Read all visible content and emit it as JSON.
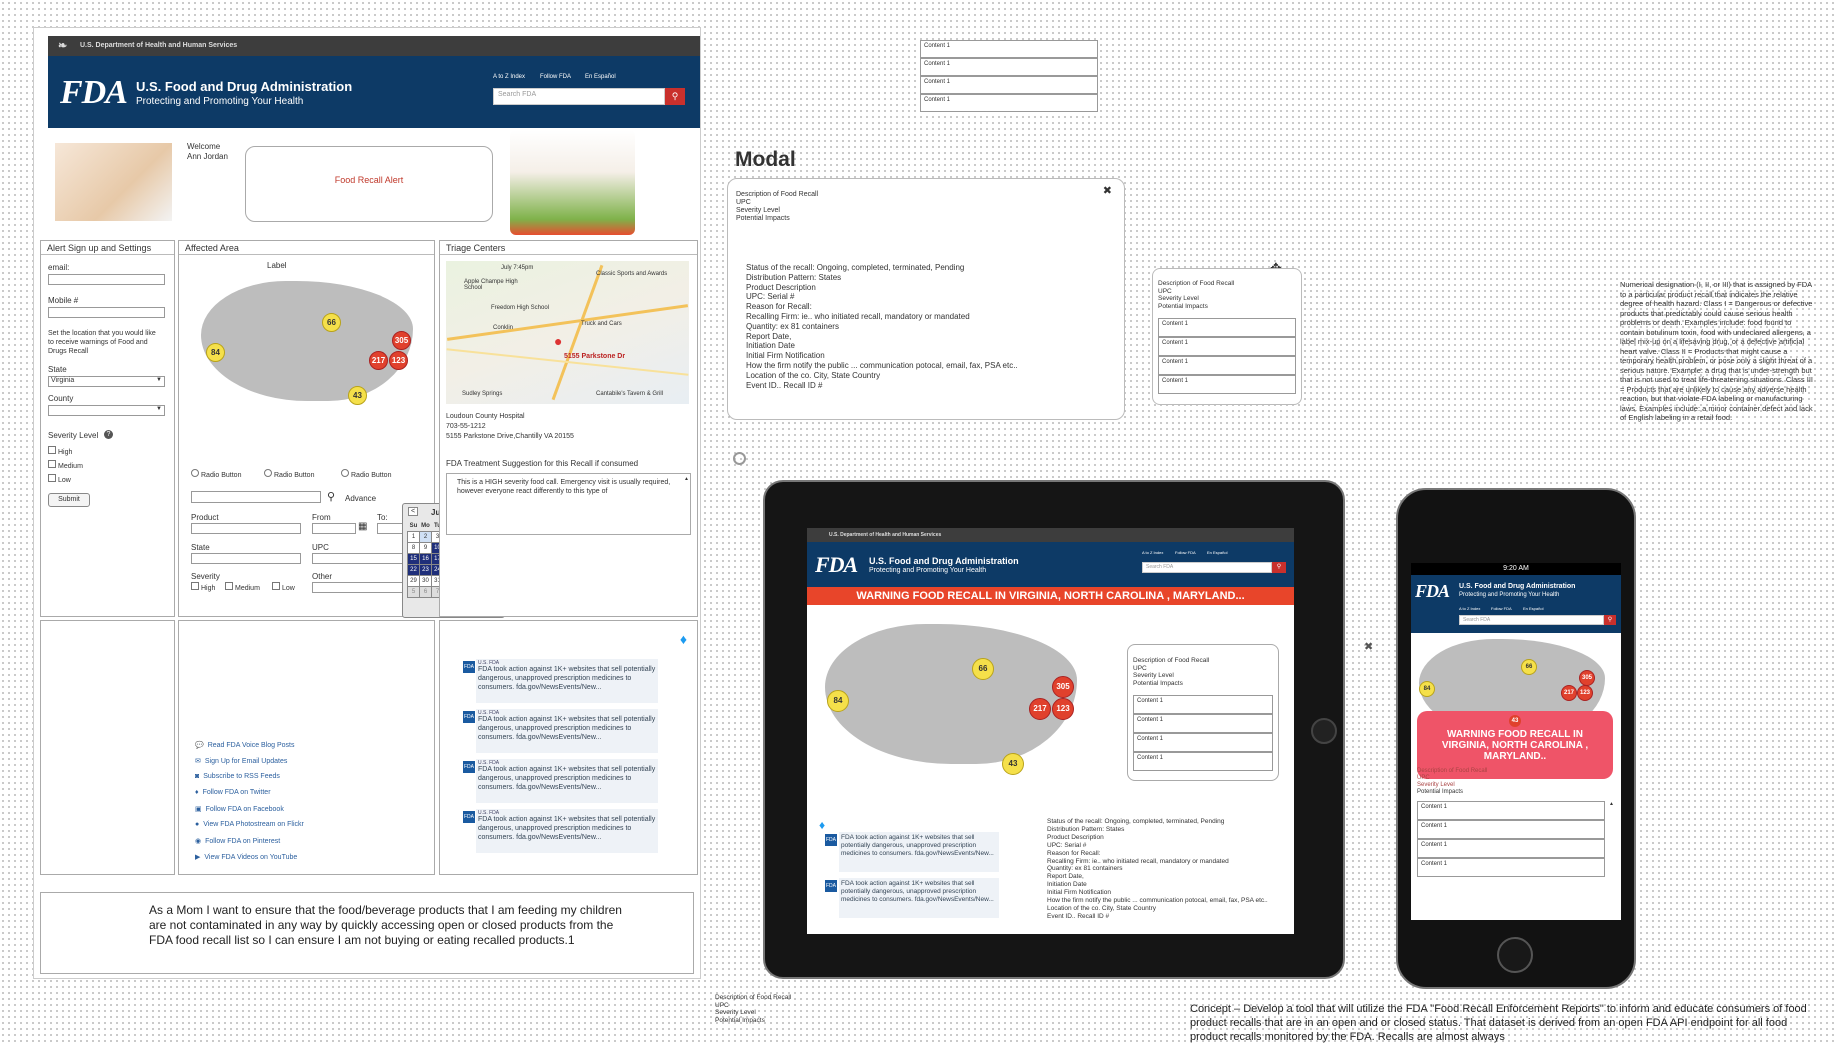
{
  "header": {
    "hhs_label": "U.S. Department of Health and Human Services",
    "title": "U.S. Food and Drug Administration",
    "subtitle": "Protecting and Promoting Your Health",
    "logo": "FDA",
    "nav": [
      "A to Z Index",
      "Follow FDA",
      "En Español"
    ],
    "search_placeholder": "Search FDA"
  },
  "welcome": {
    "label": "Welcome",
    "name": "Ann Jordan",
    "alert": "Food Recall Alert"
  },
  "alert_panel": {
    "title": "Alert Sign up and Settings",
    "email_label": "email:",
    "mobile_label": "Mobile #",
    "location_text": "Set the location that you would like to receive warnings of Food and Drugs Recall",
    "state_label": "State",
    "state_value": "Virginia",
    "county_label": "County",
    "severity_label": "Severity Level",
    "levels": [
      "High",
      "Medium",
      "Low"
    ],
    "submit": "Submit"
  },
  "affected": {
    "title": "Affected Area",
    "map_label": "Label",
    "markers": [
      "66",
      "84",
      "305",
      "217",
      "123",
      "43"
    ],
    "radios": [
      "Radio Button",
      "Radio Button",
      "Radio Button"
    ],
    "advance": "Advance",
    "product": "Product",
    "from": "From",
    "to": "To:",
    "state": "State",
    "upc": "UPC",
    "severity": "Severity",
    "other": "Other",
    "levels": [
      "High",
      "Medium",
      "Low"
    ]
  },
  "calendar": {
    "month": "July 2015",
    "days": [
      "Su",
      "Mo",
      "Tu",
      "We",
      "Th",
      "Fr",
      "Sa"
    ],
    "weeks": [
      [
        "1",
        "2",
        "3",
        "4",
        "5",
        "6",
        "7"
      ],
      [
        "8",
        "9",
        "10",
        "11",
        "12",
        "13",
        "14"
      ],
      [
        "15",
        "16",
        "17",
        "18",
        "19",
        "20",
        "21"
      ],
      [
        "22",
        "23",
        "24",
        "25",
        "26",
        "27",
        "28"
      ],
      [
        "29",
        "30",
        "31",
        "1",
        "2",
        "3",
        "4"
      ],
      [
        "5",
        "6",
        "7",
        "8",
        "9",
        "10",
        "11"
      ]
    ]
  },
  "triage": {
    "title": "Triage Centers",
    "map_places": [
      "July 7:45pm",
      "Apple Champe High School",
      "Freedom High School",
      "Conklin",
      "Truck and Cars",
      "5155 Parkstone Dr",
      "Sudley Springs",
      "Classic Sports and Awards",
      "Cantabile's Tavern & Grill"
    ],
    "hospital": "Loudoun County Hospital",
    "phone": "703-55-1212",
    "address": "5155 Parkstone Drive,Chantilly VA 20155",
    "treatment_title": "FDA Treatment Suggestion for this Recall if consumed",
    "treatment_text": "This is a HIGH severity food call. Emergency visit is usually required, however everyone react differently to this type of"
  },
  "social": {
    "links": [
      "Read FDA Voice Blog Posts",
      "Sign Up for Email Updates",
      "Subscribe to RSS Feeds",
      "Follow FDA on Twitter",
      "Follow FDA on Facebook",
      "View FDA Photostream on Flickr",
      "Follow FDA on Pinterest",
      "View FDA Videos on YouTube"
    ],
    "tweet_handle": "U.S. FDA",
    "tweet_text": "FDA took action against 1K+ websites that sell potentially dangerous, unapproved prescription medicines to consumers. fda.gov/NewsEvents/New..."
  },
  "story": "As a Mom I  want to ensure that the food/beverage products that I am feeding my children are not contaminated in any way by quickly accessing open or closed products from the FDA food recall list  so I can ensure I am not buying or eating recalled products.1",
  "list_top": [
    "Content 1",
    "Content 1",
    "Content 1",
    "Content 1"
  ],
  "modal": {
    "heading": "Modal",
    "desc_lines": [
      "Description of Food Recall",
      "UPC",
      "Severity Level",
      "Potential Impacts"
    ],
    "detail_lines": [
      "Status of the recall: Ongoing, completed, terminated, Pending",
      "Distribution Pattern: States",
      "Product Description",
      "UPC: Serial #",
      "Reason for Recall:",
      "Recalling Firm:  ie..  who initiated recall, mandatory or mandated",
      "Quantity: ex 81 containers",
      "Report Date,",
      "Initiation Date",
      "Initial Firm Notification",
      "How the firm notify the public ... communication potocal, email, fax, PSA etc..",
      "Location of the co. City, State Country",
      "Event ID.. Recall ID #"
    ],
    "close": "✖"
  },
  "small_card": {
    "desc_lines": [
      "Description of Food Recall",
      "UPC",
      "Severity Level",
      "Potential Impacts"
    ],
    "items": [
      "Content 1",
      "Content 1",
      "Content 1",
      "Content 1"
    ]
  },
  "classification": "Numerical designation (I, II, or III) that is assigned by FDA to a particular product recall that indicates the relative degree of health hazard. Class I = Dangerous or defective products that predictably could cause serious health problems or death. Examples include: food found to contain botulinum toxin, food with undeclared allergens, a label mix-up on a lifesaving drug, or a defective artificial heart valve. Class II = Products that might cause a temporary health problem, or pose only a slight threat of a serious nature. Example: a drug that is under-strength but that is not used to treat life-threatening situations. Class III = Products that are unlikely to cause any adverse health reaction, but that violate FDA labeling or manufacturing laws. Examples include: a minor container defect and lack of English labeling in a retail food.",
  "tablet": {
    "banner": "WARNING FOOD RECALL IN VIRGINIA, NORTH CAROLINA , MARYLAND..."
  },
  "phone": {
    "time": "9:20 AM",
    "banner": "WARNING FOOD RECALL IN VIRGINIA, NORTH CAROLINA , MARYLAND.."
  },
  "bottom_left": [
    "Description of Food Recall",
    "UPC",
    "Severity Level",
    "Potential Impacts"
  ],
  "concept": "Concept – Develop a tool that will utilize the FDA \"Food Recall Enforcement Reports\" to inform and educate consumers of food product recalls that are in an open and or closed status. That dataset is derived from an open FDA API endpoint for all food product recalls monitored by the FDA.  Recalls are almost always"
}
